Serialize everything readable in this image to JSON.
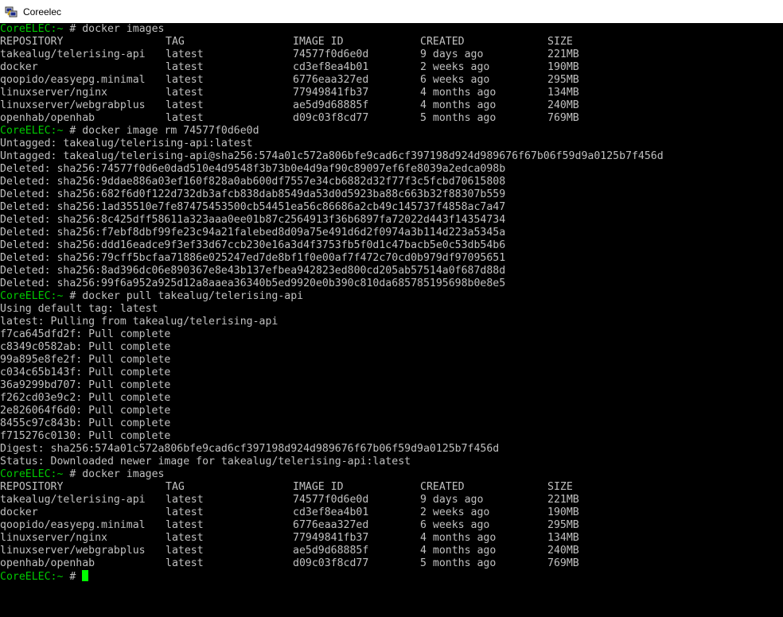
{
  "window": {
    "title": "Coreelec"
  },
  "colors": {
    "background": "#000000",
    "text": "#c0c0c0",
    "prompt": "#00c800",
    "cursor": "#00ff00"
  },
  "terminal": {
    "prompt": "CoreELEC:~ #",
    "lines": [
      {
        "type": "prompt",
        "cmd": "docker images"
      },
      {
        "type": "table",
        "cols": [
          "REPOSITORY",
          "TAG",
          "IMAGE ID",
          "CREATED",
          "SIZE"
        ]
      },
      {
        "type": "table",
        "cols": [
          "takealug/telerising-api",
          "latest",
          "74577f0d6e0d",
          "9 days ago",
          "221MB"
        ]
      },
      {
        "type": "table",
        "cols": [
          "docker",
          "latest",
          "cd3ef8ea4b01",
          "2 weeks ago",
          "190MB"
        ]
      },
      {
        "type": "table",
        "cols": [
          "qoopido/easyepg.minimal",
          "latest",
          "6776eaa327ed",
          "6 weeks ago",
          "295MB"
        ]
      },
      {
        "type": "table",
        "cols": [
          "linuxserver/nginx",
          "latest",
          "77949841fb37",
          "4 months ago",
          "134MB"
        ]
      },
      {
        "type": "table",
        "cols": [
          "linuxserver/webgrabplus",
          "latest",
          "ae5d9d68885f",
          "4 months ago",
          "240MB"
        ]
      },
      {
        "type": "table",
        "cols": [
          "openhab/openhab",
          "latest",
          "d09c03f8cd77",
          "5 months ago",
          "769MB"
        ]
      },
      {
        "type": "prompt",
        "cmd": "docker image rm 74577f0d6e0d"
      },
      {
        "type": "text",
        "text": "Untagged: takealug/telerising-api:latest"
      },
      {
        "type": "text",
        "text": "Untagged: takealug/telerising-api@sha256:574a01c572a806bfe9cad6cf397198d924d989676f67b06f59d9a0125b7f456d"
      },
      {
        "type": "text",
        "text": "Deleted: sha256:74577f0d6e0dad510e4d9548f3b73b0e4d9af90c89097ef6fe8039a2edca098b"
      },
      {
        "type": "text",
        "text": "Deleted: sha256:9ddae886a03ef160f828a0ab600df7557e34cb6882d32f77f3c5fcbd70615808"
      },
      {
        "type": "text",
        "text": "Deleted: sha256:682f6d0f122d732db3afcb838dab8549da53d0d5923ba88c663b32f88307b559"
      },
      {
        "type": "text",
        "text": "Deleted: sha256:1ad35510e7fe87475453500cb54451ea56c86686a2cb49c145737f4858ac7a47"
      },
      {
        "type": "text",
        "text": "Deleted: sha256:8c425dff58611a323aaa0ee01b87c2564913f36b6897fa72022d443f14354734"
      },
      {
        "type": "text",
        "text": "Deleted: sha256:f7ebf8dbf99fe23c94a21falebed8d09a75e491d6d2f0974a3b114d223a5345a"
      },
      {
        "type": "text",
        "text": "Deleted: sha256:ddd16eadce9f3ef33d67ccb230e16a3d4f3753fb5f0d1c47bacb5e0c53db54b6"
      },
      {
        "type": "text",
        "text": "Deleted: sha256:79cff5bcfaa71886e025247ed7de8bf1f0e00af7f472c70cd0b979df97095651"
      },
      {
        "type": "text",
        "text": "Deleted: sha256:8ad396dc06e890367e8e43b137efbea942823ed800cd205ab57514a0f687d88d"
      },
      {
        "type": "text",
        "text": "Deleted: sha256:99f6a952a925d12a8aaea36340b5ed9920e0b390c810da685785195698b0e8e5"
      },
      {
        "type": "prompt",
        "cmd": "docker pull takealug/telerising-api"
      },
      {
        "type": "text",
        "text": "Using default tag: latest"
      },
      {
        "type": "text",
        "text": "latest: Pulling from takealug/telerising-api"
      },
      {
        "type": "text",
        "text": "f7ca645dfd2f: Pull complete"
      },
      {
        "type": "text",
        "text": "c8349c0582ab: Pull complete"
      },
      {
        "type": "text",
        "text": "99a895e8fe2f: Pull complete"
      },
      {
        "type": "text",
        "text": "c034c65b143f: Pull complete"
      },
      {
        "type": "text",
        "text": "36a9299bd707: Pull complete"
      },
      {
        "type": "text",
        "text": "f262cd03e9c2: Pull complete"
      },
      {
        "type": "text",
        "text": "2e826064f6d0: Pull complete"
      },
      {
        "type": "text",
        "text": "8455c97c843b: Pull complete"
      },
      {
        "type": "text",
        "text": "f715276c0130: Pull complete"
      },
      {
        "type": "text",
        "text": "Digest: sha256:574a01c572a806bfe9cad6cf397198d924d989676f67b06f59d9a0125b7f456d"
      },
      {
        "type": "text",
        "text": "Status: Downloaded newer image for takealug/telerising-api:latest"
      },
      {
        "type": "prompt",
        "cmd": "docker images"
      },
      {
        "type": "table",
        "cols": [
          "REPOSITORY",
          "TAG",
          "IMAGE ID",
          "CREATED",
          "SIZE"
        ]
      },
      {
        "type": "table",
        "cols": [
          "takealug/telerising-api",
          "latest",
          "74577f0d6e0d",
          "9 days ago",
          "221MB"
        ]
      },
      {
        "type": "table",
        "cols": [
          "docker",
          "latest",
          "cd3ef8ea4b01",
          "2 weeks ago",
          "190MB"
        ]
      },
      {
        "type": "table",
        "cols": [
          "qoopido/easyepg.minimal",
          "latest",
          "6776eaa327ed",
          "6 weeks ago",
          "295MB"
        ]
      },
      {
        "type": "table",
        "cols": [
          "linuxserver/nginx",
          "latest",
          "77949841fb37",
          "4 months ago",
          "134MB"
        ]
      },
      {
        "type": "table",
        "cols": [
          "linuxserver/webgrabplus",
          "latest",
          "ae5d9d68885f",
          "4 months ago",
          "240MB"
        ]
      },
      {
        "type": "table",
        "cols": [
          "openhab/openhab",
          "latest",
          "d09c03f8cd77",
          "5 months ago",
          "769MB"
        ]
      },
      {
        "type": "prompt",
        "cmd": "",
        "cursor": true
      }
    ]
  }
}
